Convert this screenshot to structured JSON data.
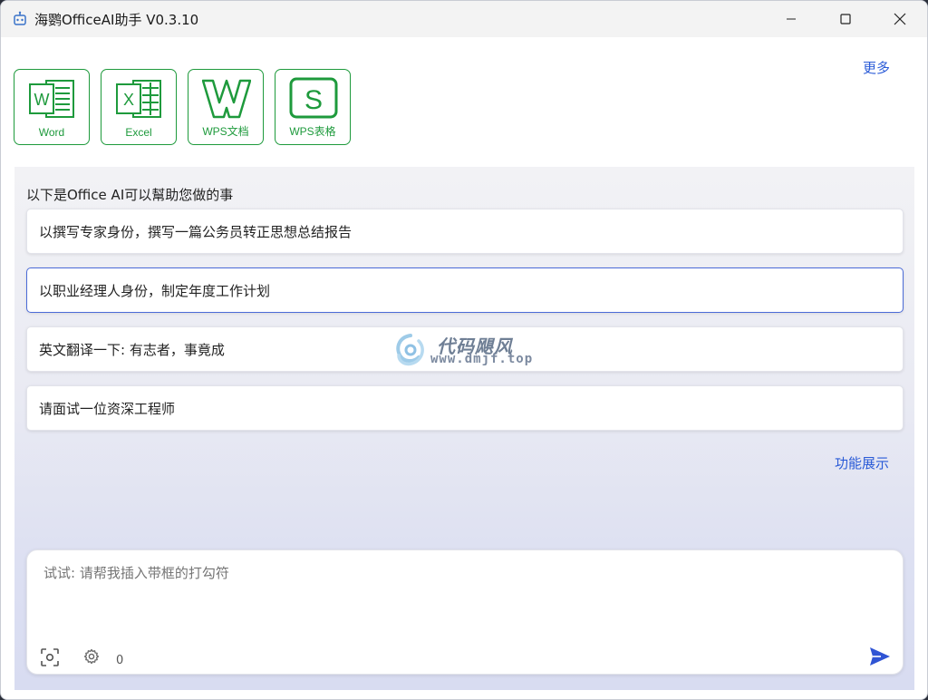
{
  "window": {
    "title": "海鹦OfficeAI助手 V0.3.10"
  },
  "toolbar": {
    "apps": [
      {
        "label": "Word",
        "icon": "word-icon"
      },
      {
        "label": "Excel",
        "icon": "excel-icon"
      },
      {
        "label": "WPS文档",
        "icon": "wps-writer-icon"
      },
      {
        "label": "WPS表格",
        "icon": "wps-spreadsheet-icon"
      }
    ],
    "more_label": "更多"
  },
  "main": {
    "intro": "以下是Office AI可以幫助您做的事",
    "suggestions": [
      "以撰写专家身份，撰写一篇公务员转正思想总结报告",
      "以职业经理人身份，制定年度工作计划",
      "英文翻译一下: 有志者，事竟成",
      "请面试一位资深工程师"
    ],
    "feature_link": "功能展示"
  },
  "input": {
    "placeholder": "试试: 请帮我插入带框的打勾符",
    "counter": "0"
  },
  "watermark": {
    "name": "代码飓风",
    "url": "www.dmjf.top"
  },
  "colors": {
    "app_green": "#1e9a3c",
    "link_blue": "#2a5bd7",
    "active_border": "#4b6bd8",
    "send_blue": "#2f54d4"
  }
}
